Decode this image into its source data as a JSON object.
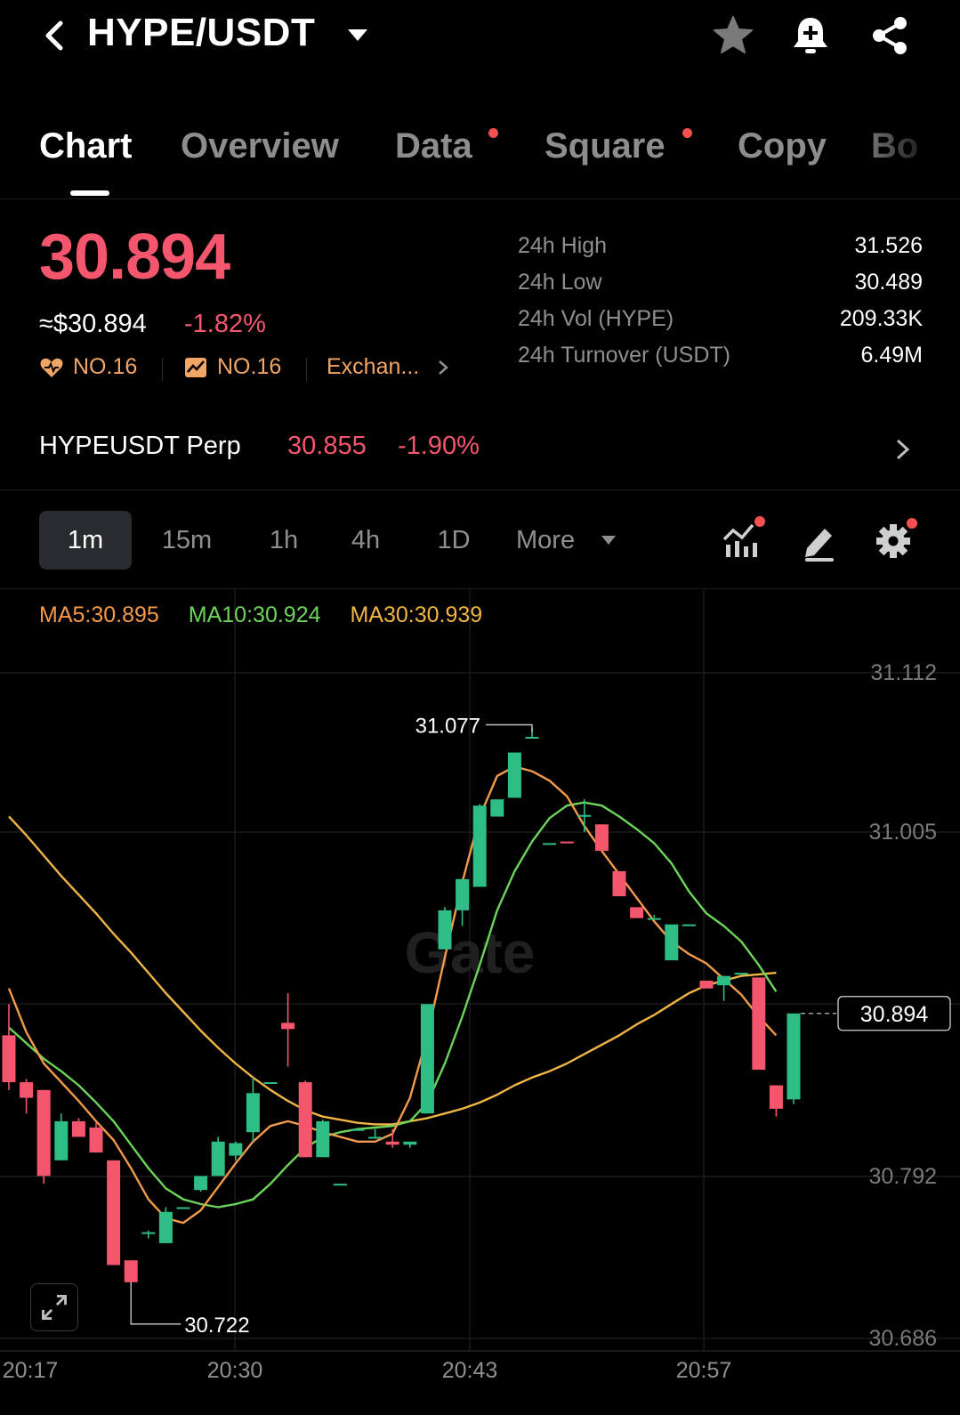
{
  "header": {
    "pair": "HYPE/USDT",
    "icons": [
      "back-icon",
      "caret-down-icon",
      "star-icon",
      "bell-plus-icon",
      "share-icon"
    ]
  },
  "tabs": [
    {
      "label": "Chart",
      "active": true,
      "dot": false
    },
    {
      "label": "Overview",
      "active": false,
      "dot": false
    },
    {
      "label": "Data",
      "active": false,
      "dot": true
    },
    {
      "label": "Square",
      "active": false,
      "dot": true
    },
    {
      "label": "Copy",
      "active": false,
      "dot": false
    },
    {
      "label": "Bo",
      "active": false,
      "dot": false
    }
  ],
  "price": {
    "last": "30.894",
    "fiat": "≈$30.894",
    "change_pct": "-1.82%",
    "rank_hot": "NO.16",
    "rank_gain": "NO.16",
    "exchange_link": "Exchan..."
  },
  "stats": [
    {
      "label": "24h High",
      "value": "31.526"
    },
    {
      "label": "24h Low",
      "value": "30.489"
    },
    {
      "label": "24h Vol (HYPE)",
      "value": "209.33K"
    },
    {
      "label": "24h Turnover (USDT)",
      "value": "6.49M"
    }
  ],
  "perp": {
    "name": "HYPEUSDT Perp",
    "price": "30.855",
    "change_pct": "-1.90%"
  },
  "intervals": [
    {
      "label": "1m",
      "active": true
    },
    {
      "label": "15m",
      "active": false
    },
    {
      "label": "1h",
      "active": false
    },
    {
      "label": "4h",
      "active": false
    },
    {
      "label": "1D",
      "active": false
    },
    {
      "label": "More",
      "active": false
    }
  ],
  "toolbar_icons": [
    "indicators-icon",
    "draw-icon",
    "settings-icon"
  ],
  "colors": {
    "up": "#2ebd85",
    "down": "#f4566d",
    "ma5": "#f39a4b",
    "ma10": "#6cd45a",
    "ma30": "#f0b544",
    "rank": "#f2a565",
    "notification_dot": "#f3504f"
  },
  "ma_legend": {
    "ma5": "MA5:30.895",
    "ma10": "MA10:30.924",
    "ma30": "MA30:30.939"
  },
  "watermark": "Gate",
  "chart_data": {
    "type": "candlestick",
    "x_tick_labels": [
      "20:17",
      "20:30",
      "20:43",
      "20:57"
    ],
    "y_tick_labels": [
      "31.112",
      "31.005",
      "30.792",
      "30.686"
    ],
    "ylim": [
      30.686,
      31.112
    ],
    "grid": true,
    "high_marker": {
      "label": "31.077",
      "value": 31.077
    },
    "low_marker": {
      "label": "30.722",
      "value": 30.722
    },
    "current_price_tag": "30.894",
    "candles": [
      {
        "o": 30.88,
        "h": 30.9,
        "c": 30.85,
        "l": 30.845
      },
      {
        "o": 30.85,
        "h": 30.852,
        "c": 30.84,
        "l": 30.83
      },
      {
        "o": 30.845,
        "h": 30.845,
        "c": 30.79,
        "l": 30.785
      },
      {
        "o": 30.8,
        "h": 30.83,
        "c": 30.825,
        "l": 30.8
      },
      {
        "o": 30.825,
        "h": 30.827,
        "c": 30.815,
        "l": 30.815
      },
      {
        "o": 30.821,
        "h": 30.824,
        "c": 30.805,
        "l": 30.805
      },
      {
        "o": 30.8,
        "h": 30.8,
        "c": 30.733,
        "l": 30.733
      },
      {
        "o": 30.736,
        "h": 30.736,
        "c": 30.722,
        "l": 30.722
      },
      {
        "o": 30.754,
        "h": 30.755,
        "c": 30.754,
        "l": 30.75
      },
      {
        "o": 30.747,
        "h": 30.77,
        "c": 30.767,
        "l": 30.747
      },
      {
        "o": 30.77,
        "h": 30.77,
        "c": 30.77,
        "l": 30.77
      },
      {
        "o": 30.781,
        "h": 30.79,
        "c": 30.79,
        "l": 30.78
      },
      {
        "o": 30.79,
        "h": 30.815,
        "c": 30.812,
        "l": 30.79
      },
      {
        "o": 30.803,
        "h": 30.812,
        "c": 30.811,
        "l": 30.8
      },
      {
        "o": 30.818,
        "h": 30.853,
        "c": 30.843,
        "l": 30.812
      },
      {
        "o": 30.85,
        "h": 30.85,
        "c": 30.85,
        "l": 30.85
      },
      {
        "o": 30.888,
        "h": 30.907,
        "c": 30.884,
        "l": 30.86
      },
      {
        "o": 30.85,
        "h": 30.851,
        "c": 30.802,
        "l": 30.802
      },
      {
        "o": 30.802,
        "h": 30.826,
        "c": 30.825,
        "l": 30.802
      },
      {
        "o": 30.784,
        "h": 30.785,
        "c": 30.785,
        "l": 30.784
      },
      {
        "o": 30.82,
        "h": 30.82,
        "c": 30.82,
        "l": 30.82
      },
      {
        "o": 30.815,
        "h": 30.82,
        "c": 30.815,
        "l": 30.815
      },
      {
        "o": 30.812,
        "h": 30.82,
        "c": 30.81,
        "l": 30.808
      },
      {
        "o": 30.81,
        "h": 30.812,
        "c": 30.812,
        "l": 30.808
      },
      {
        "o": 30.83,
        "h": 30.86,
        "c": 30.9,
        "l": 30.83
      },
      {
        "o": 30.935,
        "h": 30.962,
        "c": 30.96,
        "l": 30.935
      },
      {
        "o": 30.96,
        "h": 30.98,
        "c": 30.98,
        "l": 30.95
      },
      {
        "o": 30.975,
        "h": 31.028,
        "c": 31.027,
        "l": 30.975
      },
      {
        "o": 31.02,
        "h": 31.031,
        "c": 31.031,
        "l": 31.02
      },
      {
        "o": 31.032,
        "h": 31.061,
        "c": 31.061,
        "l": 31.032
      },
      {
        "o": 31.071,
        "h": 31.077,
        "c": 31.071,
        "l": 31.07
      },
      {
        "o": 31.003,
        "h": 31.003,
        "c": 31.003,
        "l": 31.003
      },
      {
        "o": 31.004,
        "h": 31.004,
        "c": 31.003,
        "l": 31.003
      },
      {
        "o": 31.02,
        "h": 31.031,
        "c": 31.021,
        "l": 31.01
      },
      {
        "o": 31.015,
        "h": 31.015,
        "c": 30.998,
        "l": 30.998
      },
      {
        "o": 30.985,
        "h": 30.985,
        "c": 30.969,
        "l": 30.969
      },
      {
        "o": 30.962,
        "h": 30.962,
        "c": 30.955,
        "l": 30.955
      },
      {
        "o": 30.955,
        "h": 30.957,
        "c": 30.955,
        "l": 30.955
      },
      {
        "o": 30.928,
        "h": 30.951,
        "c": 30.951,
        "l": 30.928
      },
      {
        "o": 30.951,
        "h": 30.951,
        "c": 30.951,
        "l": 30.951
      },
      {
        "o": 30.915,
        "h": 30.915,
        "c": 30.91,
        "l": 30.91
      },
      {
        "o": 30.912,
        "h": 30.918,
        "c": 30.918,
        "l": 30.902
      },
      {
        "o": 30.92,
        "h": 30.92,
        "c": 30.92,
        "l": 30.92
      },
      {
        "o": 30.917,
        "h": 30.917,
        "c": 30.858,
        "l": 30.858
      },
      {
        "o": 30.848,
        "h": 30.848,
        "c": 30.833,
        "l": 30.828
      },
      {
        "o": 30.839,
        "h": 30.894,
        "c": 30.894,
        "l": 30.836
      }
    ],
    "ma5": [
      30.91,
      30.882,
      30.862,
      30.85,
      30.838,
      30.825,
      30.813,
      30.795,
      30.775,
      30.763,
      30.76,
      30.768,
      30.783,
      30.798,
      30.812,
      30.822,
      30.825,
      30.822,
      30.818,
      30.815,
      30.812,
      30.812,
      30.817,
      30.84,
      30.88,
      30.93,
      30.978,
      31.02,
      31.046,
      31.052,
      31.049,
      31.043,
      31.033,
      31.014,
      30.998,
      30.983,
      30.968,
      30.953,
      30.94,
      30.932,
      30.926,
      30.916,
      30.906,
      30.892,
      30.88
    ],
    "ma10": [
      30.885,
      30.875,
      30.865,
      30.857,
      30.848,
      30.837,
      30.825,
      30.81,
      30.795,
      30.782,
      30.775,
      30.772,
      30.77,
      30.772,
      30.775,
      30.785,
      30.797,
      30.808,
      30.815,
      30.818,
      30.82,
      30.821,
      30.822,
      30.825,
      30.837,
      30.862,
      30.892,
      30.925,
      30.96,
      30.985,
      31.004,
      31.019,
      31.027,
      31.029,
      31.027,
      31.02,
      31.012,
      31.003,
      30.99,
      30.972,
      30.958,
      30.95,
      30.94,
      30.925,
      30.908
    ],
    "ma30": [
      31.02,
      31.008,
      30.995,
      30.982,
      30.97,
      30.958,
      30.945,
      30.933,
      30.92,
      30.907,
      30.895,
      30.883,
      30.872,
      30.862,
      30.853,
      30.845,
      30.838,
      30.832,
      30.828,
      30.826,
      30.824,
      30.823,
      30.823,
      30.825,
      30.827,
      30.83,
      30.833,
      30.837,
      30.842,
      30.848,
      30.853,
      30.857,
      30.862,
      30.868,
      30.874,
      30.88,
      30.887,
      30.893,
      30.9,
      30.907,
      30.912,
      30.915,
      30.918,
      30.919,
      30.92
    ]
  }
}
